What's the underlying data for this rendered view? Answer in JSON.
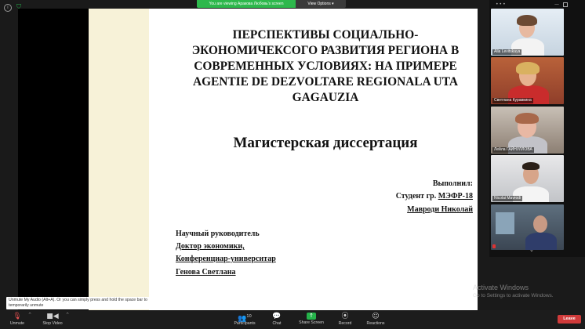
{
  "banner": {
    "viewing_text": "You are viewing Аракова Любовь's screen",
    "view_options_label": "View Options ▾"
  },
  "slide": {
    "title_lines": [
      "ПЕРСПЕКТИВЫ СОЦИАЛЬНО-",
      "ЭКОНОМИЧЕКСОГО РАЗВИТИЯ РЕГИОНА В",
      "СОВРЕМЕННЫХ УСЛОВИЯХ: НА ПРИМЕРЕ",
      "AGENTIE DE DEZVOLTARE REGIONALA UTA",
      "GAGAUZIA"
    ],
    "subtitle": "Магистерская диссертация",
    "done_label": "Выполнил:",
    "student_prefix": "Студент гр. ",
    "student_group": "МЭФР-18",
    "author_name": "Мавроди Николай",
    "supervisor_label": "Научный руководитель",
    "supervisor_degree": "Доктор экономики,",
    "supervisor_title": "Конференциар-университар",
    "supervisor_name": "Генова Светлана"
  },
  "participants": [
    {
      "name": "Alla Levitskaya"
    },
    {
      "name": "Светлана Куравкина"
    },
    {
      "name": "Лейла ГАЙНУЛЛОВА"
    },
    {
      "name": "Nicolai Mavrodi"
    },
    {
      "name": ""
    }
  ],
  "watermark": {
    "line1": "Activate Windows",
    "line2": "Go to Settings to activate Windows."
  },
  "tooltip": {
    "text": "Unmute My Audio (Alt+A). Or you can simply press and hold the space bar to temporarily unmute"
  },
  "toolbar": {
    "unmute": "Unmute",
    "stop_video": "Stop Video",
    "participants": "Participants",
    "participants_count": "10",
    "chat": "Chat",
    "share_screen": "Share Screen",
    "record": "Record",
    "reactions": "Reactions",
    "leave": "Leave"
  },
  "colors": {
    "accent_green": "#25b24a",
    "leave_red": "#d03b3b",
    "slide_side": "#f7f2d8"
  }
}
